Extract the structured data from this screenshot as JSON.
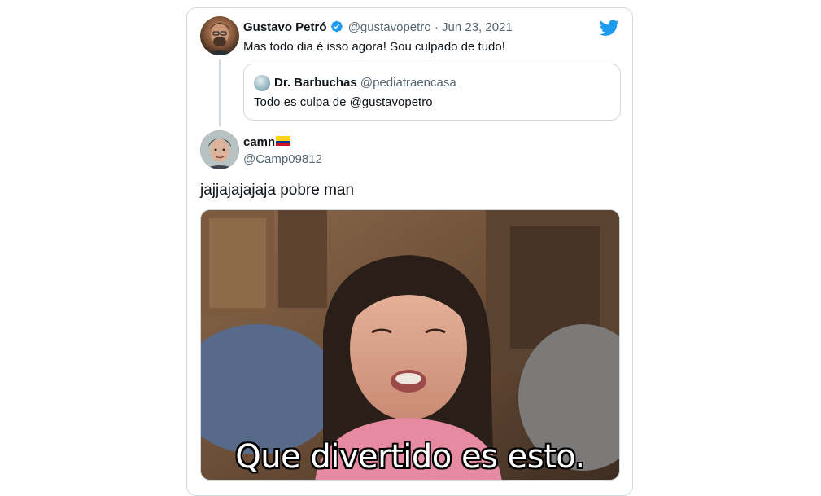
{
  "tweet": {
    "author_name": "Gustavo Petró",
    "author_handle": "@gustavopetro",
    "separator": "·",
    "date": "Jun 23, 2021",
    "text": "Mas todo dia é isso agora! Sou culpado de tudo!"
  },
  "quoted": {
    "author_name": "Dr. Barbuchas",
    "author_handle": "@pediatraencasa",
    "text": "Todo es culpa de @gustavopetro"
  },
  "reply": {
    "author_name": "camn",
    "author_handle": "@Camp09812",
    "text": "jajjajajajaja pobre man",
    "media_caption": "Que divertido es esto."
  },
  "colors": {
    "twitter_blue": "#1d9bf0",
    "text_primary": "#0f1419",
    "text_secondary": "#536471",
    "border": "#cfd9de"
  },
  "icons": {
    "platform": "twitter-bird-icon",
    "verified": "verified-badge-icon",
    "flag": "colombia-flag-icon"
  }
}
